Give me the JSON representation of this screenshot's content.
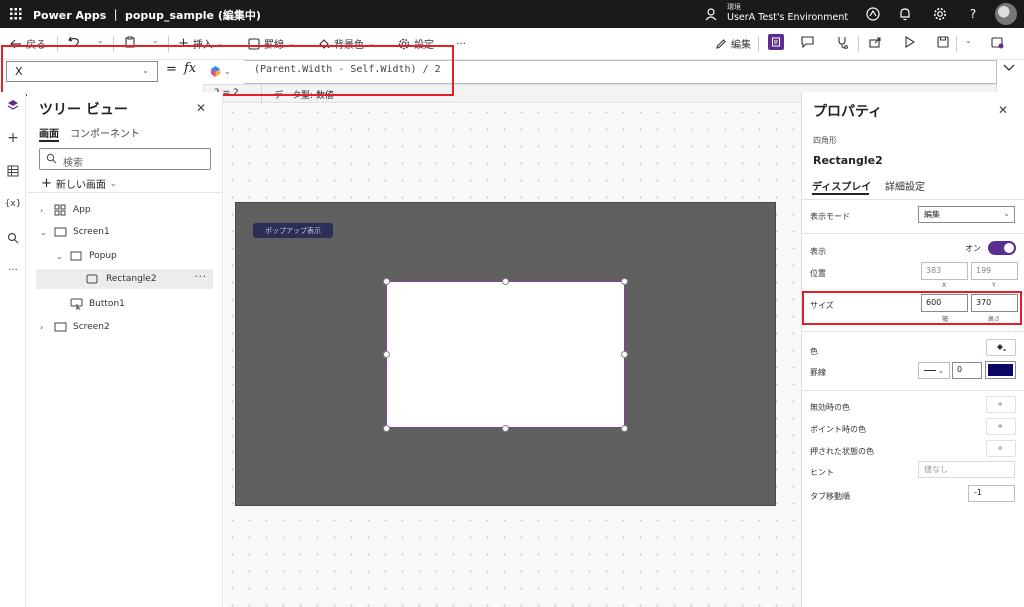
{
  "titlebar": {
    "app_name": "Power Apps ｜ popup_sample (編集中)",
    "env_label": "環境",
    "env_name": "UserA Test's Environment"
  },
  "cmdbar": {
    "back": "戻る",
    "insert": "挿入",
    "border": "罫線",
    "background": "背景色",
    "settings": "設定",
    "more": "…",
    "edit": "編集"
  },
  "formula": {
    "property": "X",
    "equals": "=",
    "fx": "fx",
    "expression": "(Parent.Width - Self.Width) / 2",
    "result_value": "2 = 2",
    "result_type": "データ型: 数値"
  },
  "tree": {
    "title": "ツリー ビュー",
    "tab_screens": "画面",
    "tab_components": "コンポーネント",
    "search_placeholder": "検索",
    "new_screen": "新しい画面",
    "items": [
      "App",
      "Screen1",
      "Popup",
      "Rectangle2",
      "Button1",
      "Screen2"
    ]
  },
  "canvas": {
    "popup_button_label": "ポップアップ表示"
  },
  "props": {
    "title": "プロパティ",
    "control_type": "四角形",
    "control_name": "Rectangle2",
    "tab_display": "ディスプレイ",
    "tab_advanced": "詳細設定",
    "display_mode_label": "表示モード",
    "display_mode_value": "編集",
    "visible_label": "表示",
    "visible_value": "オン",
    "position_label": "位置",
    "x_value": "383",
    "y_value": "199",
    "x_sub": "X",
    "y_sub": "Y",
    "size_label": "サイズ",
    "width_value": "600",
    "height_value": "370",
    "width_sub": "幅",
    "height_sub": "高さ",
    "color_label": "色",
    "border_label": "罫線",
    "border_width": "0",
    "border_color": "#0d0563",
    "disabled_color_label": "無効時の色",
    "hover_color_label": "ポイント時の色",
    "pressed_color_label": "押された状態の色",
    "hint_label": "ヒント",
    "hint_placeholder": "値なし",
    "tab_index_label": "タブ移動順",
    "tab_index_value": "-1"
  },
  "colors": {
    "accent": "#5c2e91",
    "highlight": "#e3202a",
    "screen_bg": "#606060"
  }
}
